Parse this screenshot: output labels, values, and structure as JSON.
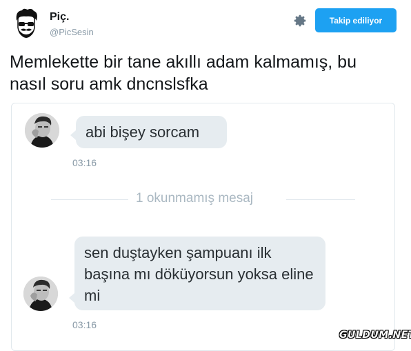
{
  "author": {
    "name": "Piç.",
    "handle": "@PicSesin"
  },
  "follow_button": {
    "label": "Takip ediliyor",
    "color": "#1da1f2"
  },
  "settings_icon": "gear-icon",
  "tweet": {
    "text": "Memlekette bir tane akıllı adam kalmamış, bu nasıl soru amk dncnslsfka"
  },
  "chat": {
    "message1": {
      "text": "abi bişey sorcam",
      "time": "03:16"
    },
    "unread_divider": "1 okunmamış mesaj",
    "message2": {
      "text": "sen duştayken şampuanı ilk başına mı döküyorsun yoksa eline mi",
      "time": "03:16"
    }
  },
  "watermark": "GULDUM.NET"
}
